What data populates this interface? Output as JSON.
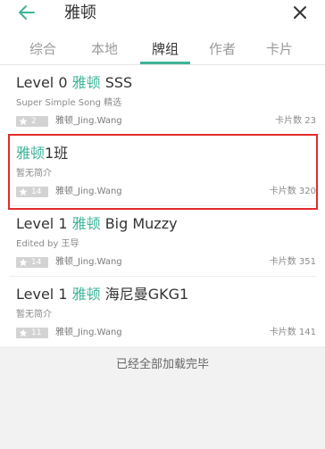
{
  "header": {
    "title": "雅顿",
    "back_icon": "arrow-left-icon",
    "close_icon": "close-icon",
    "accent": "#3fb49a"
  },
  "tabs": [
    {
      "label": "综合",
      "active": false
    },
    {
      "label": "本地",
      "active": false
    },
    {
      "label": "牌组",
      "active": true
    },
    {
      "label": "作者",
      "active": false
    },
    {
      "label": "卡片",
      "active": false
    }
  ],
  "decks": [
    {
      "title_prefix": "Level 0 ",
      "title_highlight": "雅顿",
      "title_suffix": " SSS",
      "description": "Super Simple Song 精选",
      "stars": "2",
      "author": "雅顿_Jing.Wang",
      "card_count_label": "卡片数 23",
      "highlighted": false
    },
    {
      "title_prefix": "",
      "title_highlight": "雅顿",
      "title_suffix": "1班",
      "description": "暂无简介",
      "stars": "14",
      "author": "雅顿_Jing.Wang",
      "card_count_label": "卡片数 320",
      "highlighted": true
    },
    {
      "title_prefix": "Level 1 ",
      "title_highlight": "雅顿",
      "title_suffix": " Big Muzzy",
      "description": "Edited by 王导",
      "stars": "14",
      "author": "雅顿_Jing.Wang",
      "card_count_label": "卡片数 351",
      "highlighted": false
    },
    {
      "title_prefix": "Level 1 ",
      "title_highlight": "雅顿",
      "title_suffix": " 海尼曼GKG1",
      "description": "暂无简介",
      "stars": "11",
      "author": "雅顿_Jing.Wang",
      "card_count_label": "卡片数 141",
      "highlighted": false
    }
  ],
  "footer": {
    "end_text": "已经全部加载完毕"
  },
  "colors": {
    "highlight_border": "#e32b2b",
    "accent": "#3fb49a"
  }
}
